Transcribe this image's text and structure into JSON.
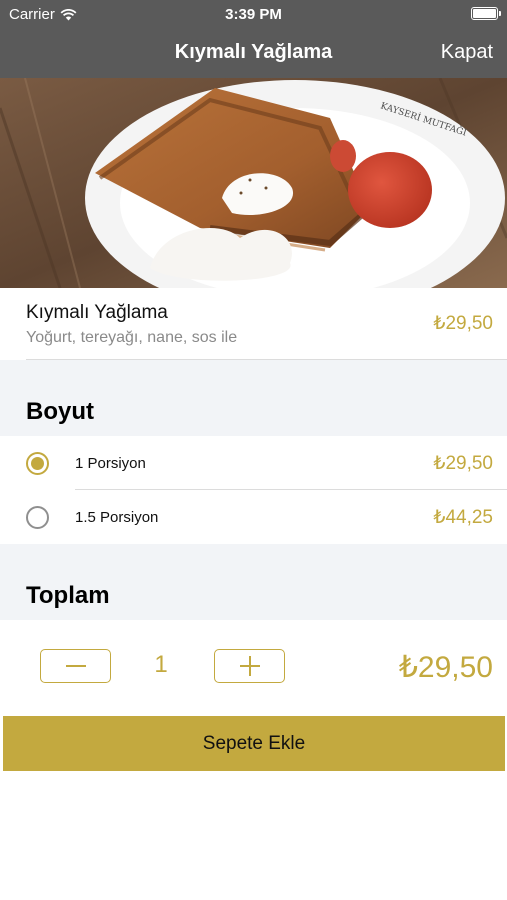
{
  "status_bar": {
    "carrier": "Carrier",
    "time": "3:39 PM"
  },
  "nav": {
    "title": "Kıymalı Yağlama",
    "close_label": "Kapat"
  },
  "product": {
    "name": "Kıymalı Yağlama",
    "description": "Yoğurt, tereyağı, nane, sos ile",
    "price": "₺29,50",
    "image_plate_text": "KAYSERİ MUTFAĞI"
  },
  "size_section": {
    "title": "Boyut",
    "options": [
      {
        "label": "1 Porsiyon",
        "price": "₺29,50",
        "selected": true
      },
      {
        "label": "1.5 Porsiyon",
        "price": "₺44,25",
        "selected": false
      }
    ]
  },
  "total_section": {
    "title": "Toplam",
    "quantity": "1",
    "total_price": "₺29,50"
  },
  "add_to_cart_label": "Sepete Ekle",
  "colors": {
    "accent": "#c3a93f",
    "navbar": "#5a5a5a",
    "section_bg": "#f2f4f7"
  }
}
